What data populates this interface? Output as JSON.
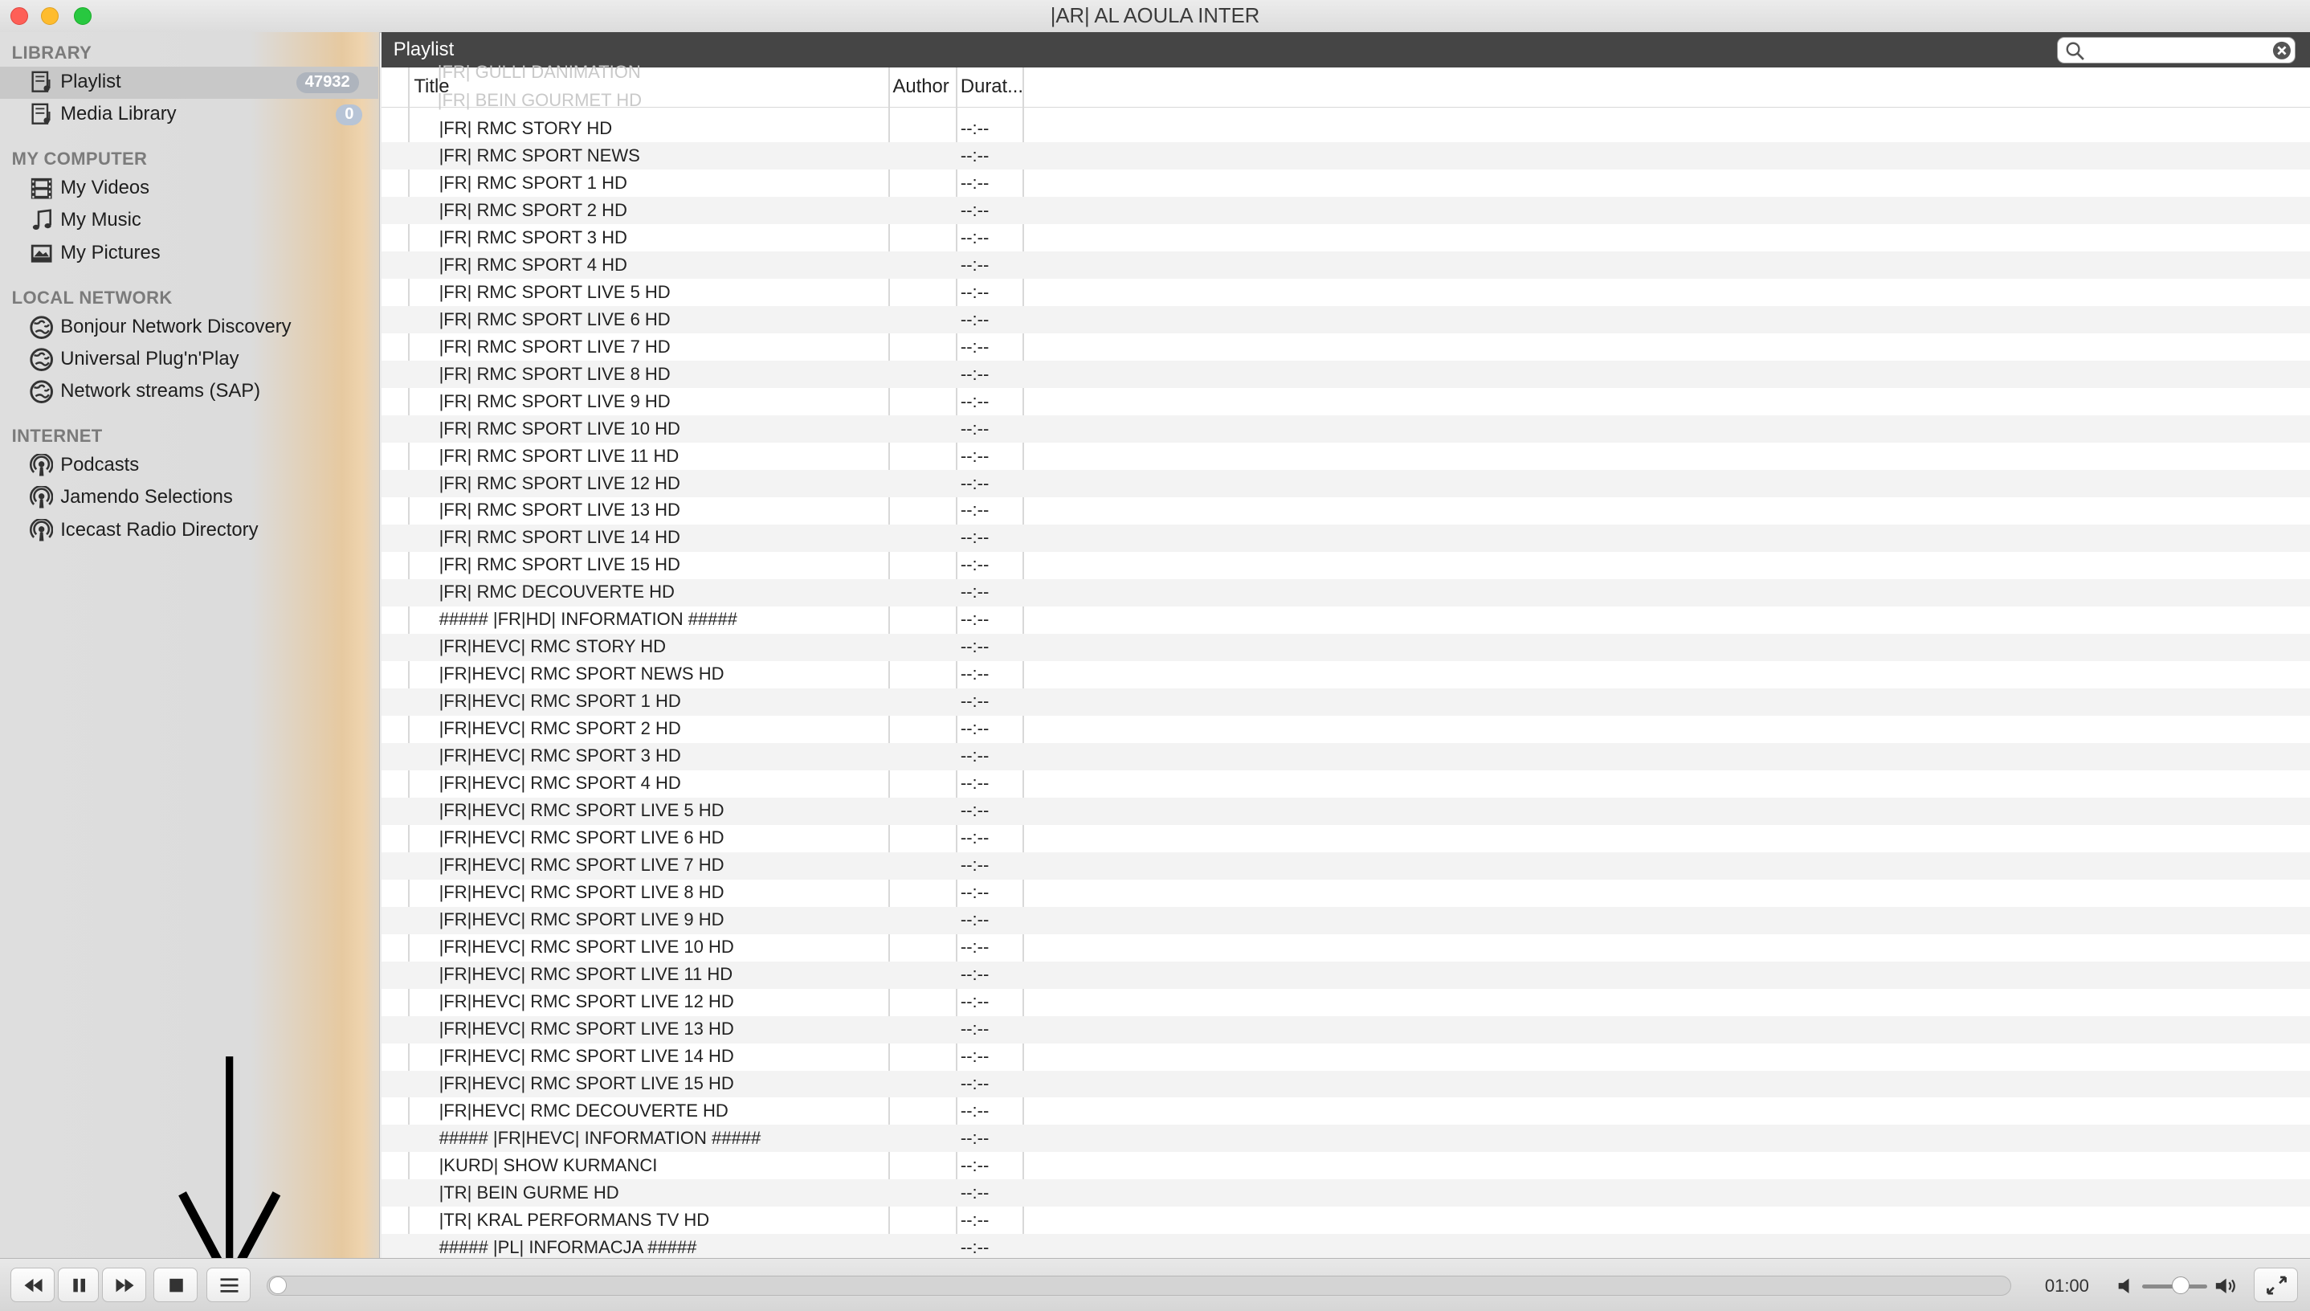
{
  "window": {
    "title": "|AR| AL AOULA INTER"
  },
  "sidebar": {
    "sections": [
      {
        "label": "LIBRARY"
      },
      {
        "label": "MY COMPUTER"
      },
      {
        "label": "LOCAL NETWORK"
      },
      {
        "label": "INTERNET"
      }
    ],
    "library": [
      {
        "label": "Playlist",
        "badge": "47932",
        "icon": "playlist-icon"
      },
      {
        "label": "Media Library",
        "badge": "0",
        "icon": "playlist-icon"
      }
    ],
    "my_computer": [
      {
        "label": "My Videos",
        "icon": "film-icon"
      },
      {
        "label": "My Music",
        "icon": "music-note-icon"
      },
      {
        "label": "My Pictures",
        "icon": "picture-icon"
      }
    ],
    "local_network": [
      {
        "label": "Bonjour Network Discovery",
        "icon": "network-icon"
      },
      {
        "label": "Universal Plug'n'Play",
        "icon": "network-icon"
      },
      {
        "label": "Network streams (SAP)",
        "icon": "network-icon"
      }
    ],
    "internet": [
      {
        "label": "Podcasts",
        "icon": "podcast-icon"
      },
      {
        "label": "Jamendo Selections",
        "icon": "podcast-icon"
      },
      {
        "label": "Icecast Radio Directory",
        "icon": "podcast-icon"
      }
    ]
  },
  "playlist": {
    "title": "Playlist",
    "search": {
      "value": "",
      "placeholder": ""
    },
    "ghost_rows": [
      "|FR| GULLI DANIMATION",
      "|FR| BEIN GOURMET HD"
    ],
    "columns": {
      "title": "Title",
      "author": "Author",
      "duration": "Durat..."
    },
    "rows": [
      {
        "title": "|FR| RMC STORY HD",
        "author": "",
        "duration": "--:--"
      },
      {
        "title": "|FR| RMC SPORT NEWS",
        "author": "",
        "duration": "--:--"
      },
      {
        "title": "|FR| RMC SPORT 1 HD",
        "author": "",
        "duration": "--:--"
      },
      {
        "title": "|FR| RMC SPORT 2 HD",
        "author": "",
        "duration": "--:--"
      },
      {
        "title": "|FR| RMC SPORT 3 HD",
        "author": "",
        "duration": "--:--"
      },
      {
        "title": "|FR| RMC SPORT 4 HD",
        "author": "",
        "duration": "--:--"
      },
      {
        "title": "|FR| RMC SPORT LIVE 5 HD",
        "author": "",
        "duration": "--:--"
      },
      {
        "title": "|FR| RMC SPORT LIVE 6 HD",
        "author": "",
        "duration": "--:--"
      },
      {
        "title": "|FR| RMC SPORT LIVE 7 HD",
        "author": "",
        "duration": "--:--"
      },
      {
        "title": "|FR| RMC SPORT LIVE 8 HD",
        "author": "",
        "duration": "--:--"
      },
      {
        "title": "|FR| RMC SPORT LIVE 9 HD",
        "author": "",
        "duration": "--:--"
      },
      {
        "title": "|FR| RMC SPORT LIVE 10 HD",
        "author": "",
        "duration": "--:--"
      },
      {
        "title": "|FR| RMC SPORT LIVE 11 HD",
        "author": "",
        "duration": "--:--"
      },
      {
        "title": "|FR| RMC SPORT LIVE 12 HD",
        "author": "",
        "duration": "--:--"
      },
      {
        "title": "|FR| RMC SPORT LIVE 13 HD",
        "author": "",
        "duration": "--:--"
      },
      {
        "title": "|FR| RMC SPORT LIVE 14 HD",
        "author": "",
        "duration": "--:--"
      },
      {
        "title": "|FR| RMC SPORT LIVE 15 HD",
        "author": "",
        "duration": "--:--"
      },
      {
        "title": "|FR| RMC DECOUVERTE HD",
        "author": "",
        "duration": "--:--"
      },
      {
        "title": "##### |FR|HD| INFORMATION #####",
        "author": "",
        "duration": "--:--"
      },
      {
        "title": "|FR|HEVC| RMC STORY HD",
        "author": "",
        "duration": "--:--"
      },
      {
        "title": "|FR|HEVC| RMC SPORT NEWS HD",
        "author": "",
        "duration": "--:--"
      },
      {
        "title": "|FR|HEVC| RMC SPORT 1 HD",
        "author": "",
        "duration": "--:--"
      },
      {
        "title": "|FR|HEVC| RMC SPORT 2 HD",
        "author": "",
        "duration": "--:--"
      },
      {
        "title": "|FR|HEVC| RMC SPORT 3 HD",
        "author": "",
        "duration": "--:--"
      },
      {
        "title": "|FR|HEVC| RMC SPORT 4 HD",
        "author": "",
        "duration": "--:--"
      },
      {
        "title": "|FR|HEVC| RMC SPORT LIVE 5 HD",
        "author": "",
        "duration": "--:--"
      },
      {
        "title": "|FR|HEVC| RMC SPORT LIVE 6 HD",
        "author": "",
        "duration": "--:--"
      },
      {
        "title": "|FR|HEVC| RMC SPORT LIVE 7 HD",
        "author": "",
        "duration": "--:--"
      },
      {
        "title": "|FR|HEVC| RMC SPORT LIVE 8 HD",
        "author": "",
        "duration": "--:--"
      },
      {
        "title": "|FR|HEVC| RMC SPORT LIVE 9 HD",
        "author": "",
        "duration": "--:--"
      },
      {
        "title": "|FR|HEVC| RMC SPORT LIVE 10 HD",
        "author": "",
        "duration": "--:--"
      },
      {
        "title": "|FR|HEVC| RMC SPORT LIVE 11 HD",
        "author": "",
        "duration": "--:--"
      },
      {
        "title": "|FR|HEVC| RMC SPORT LIVE 12 HD",
        "author": "",
        "duration": "--:--"
      },
      {
        "title": "|FR|HEVC| RMC SPORT LIVE 13 HD",
        "author": "",
        "duration": "--:--"
      },
      {
        "title": "|FR|HEVC| RMC SPORT LIVE 14 HD",
        "author": "",
        "duration": "--:--"
      },
      {
        "title": "|FR|HEVC| RMC SPORT LIVE 15 HD",
        "author": "",
        "duration": "--:--"
      },
      {
        "title": "|FR|HEVC| RMC DECOUVERTE HD",
        "author": "",
        "duration": "--:--"
      },
      {
        "title": "##### |FR|HEVC| INFORMATION #####",
        "author": "",
        "duration": "--:--"
      },
      {
        "title": "|KURD| SHOW KURMANCI",
        "author": "",
        "duration": "--:--"
      },
      {
        "title": "|TR| BEIN GURME HD",
        "author": "",
        "duration": "--:--"
      },
      {
        "title": "|TR| KRAL PERFORMANS TV HD",
        "author": "",
        "duration": "--:--"
      },
      {
        "title": "##### |PL| INFORMACJA #####",
        "author": "",
        "duration": "--:--"
      }
    ]
  },
  "controls": {
    "elapsed": "01:00",
    "progress": 0.0,
    "volume": 0.6,
    "buttons": [
      "rewind-icon",
      "pause-icon",
      "fast-forward-icon",
      "stop-icon",
      "playlist-toggle-icon",
      "fullscreen-icon"
    ]
  },
  "colors": {
    "header_bar": "#454545",
    "sidebar_selection": "#c8c8c8",
    "badge_filled": "#aeb4bd",
    "badge_zero": "#b7c4d6",
    "close": "#fe5f57",
    "minimize": "#febc2e",
    "maximize": "#28c840"
  }
}
